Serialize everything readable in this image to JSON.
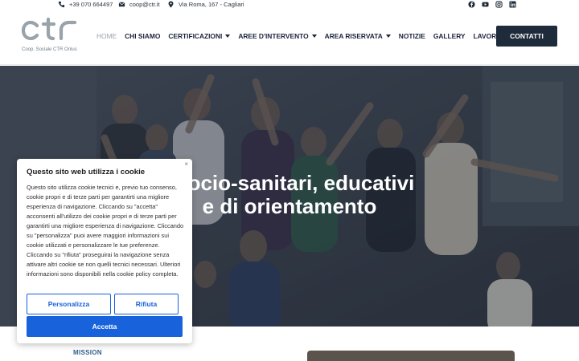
{
  "topbar": {
    "phone": "+39 070 664497",
    "email": "coop@ctr.it",
    "address": "Via Roma, 167 - Cagliari",
    "social": [
      "facebook-icon",
      "youtube-icon",
      "instagram-icon",
      "linkedin-icon"
    ]
  },
  "header": {
    "logo_text": "ctr",
    "logo_subtitle": "Coop. Sociale CTR Onlus",
    "nav": [
      {
        "label": "HOME",
        "active": true
      },
      {
        "label": "CHI SIAMO"
      },
      {
        "label": "CERTIFICAZIONI",
        "dropdown": true
      },
      {
        "label": "AREE D'INTERVENTO",
        "dropdown": true
      },
      {
        "label": "AREA RISERVATA",
        "dropdown": true
      },
      {
        "label": "NOTIZIE"
      },
      {
        "label": "GALLERY"
      },
      {
        "label": "LAVORA CON NOI"
      }
    ],
    "cta_label": "CONTATTI"
  },
  "hero": {
    "title_line1": "i socio-sanitari, educativi",
    "title_line2": "e di orientamento"
  },
  "section": {
    "mission_label": "MISSION"
  },
  "cookie": {
    "close": "×",
    "title": "Questo sito web utilizza i cookie",
    "text": "Questo sito utilizza cookie tecnici e, previo tuo consenso, cookie propri e di terze parti per garantirti una migliore esperienza di navigazione. Cliccando su \"accetta\" acconsenti all'utilizzo dei cookie propri e di terze parti per garantirti una migliore esperienza di navigazione. Cliccando su \"personalizza\" puoi avere maggiori informazioni sui cookie utilizzati e personalizzare le tue preferenze. Cliccando su \"rifiuta\" proseguirai la navigazione senza attivare altri cookie se non quelli tecnici necessari. Ulteriori informazioni sono disponibili nella cookie policy completa.",
    "customize_label": "Personalizza",
    "reject_label": "Rifiuta",
    "accept_label": "Accetta"
  },
  "colors": {
    "accent": "#1863dc",
    "cta_bg": "#1d2b3a",
    "nav_text": "#19233a",
    "nav_active": "#9aa2a8",
    "mission": "#2f5f8f"
  }
}
